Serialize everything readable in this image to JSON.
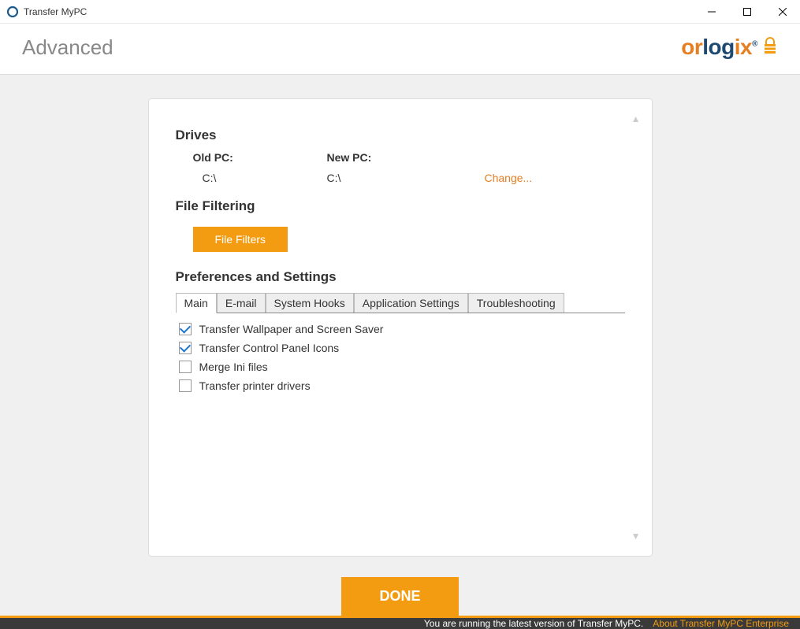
{
  "window": {
    "title": "Transfer MyPC"
  },
  "header": {
    "page_title": "Advanced",
    "logo_or": "or",
    "logo_log": "log",
    "logo_ix": "ix"
  },
  "drives": {
    "heading": "Drives",
    "old_label": "Old PC:",
    "new_label": "New PC:",
    "old_value": "C:\\",
    "new_value": "C:\\",
    "change_label": "Change..."
  },
  "filtering": {
    "heading": "File Filtering",
    "button_label": "File Filters"
  },
  "prefs": {
    "heading": "Preferences and Settings",
    "tabs": [
      "Main",
      "E-mail",
      "System Hooks",
      "Application Settings",
      "Troubleshooting"
    ],
    "options": [
      {
        "label": "Transfer Wallpaper and Screen Saver",
        "checked": true
      },
      {
        "label": "Transfer Control Panel Icons",
        "checked": true
      },
      {
        "label": "Merge Ini files",
        "checked": false
      },
      {
        "label": "Transfer printer drivers",
        "checked": false
      }
    ]
  },
  "done_label": "DONE",
  "footer": {
    "status": "You are running the latest version of Transfer MyPC.",
    "link": "About Transfer MyPC Enterprise"
  }
}
